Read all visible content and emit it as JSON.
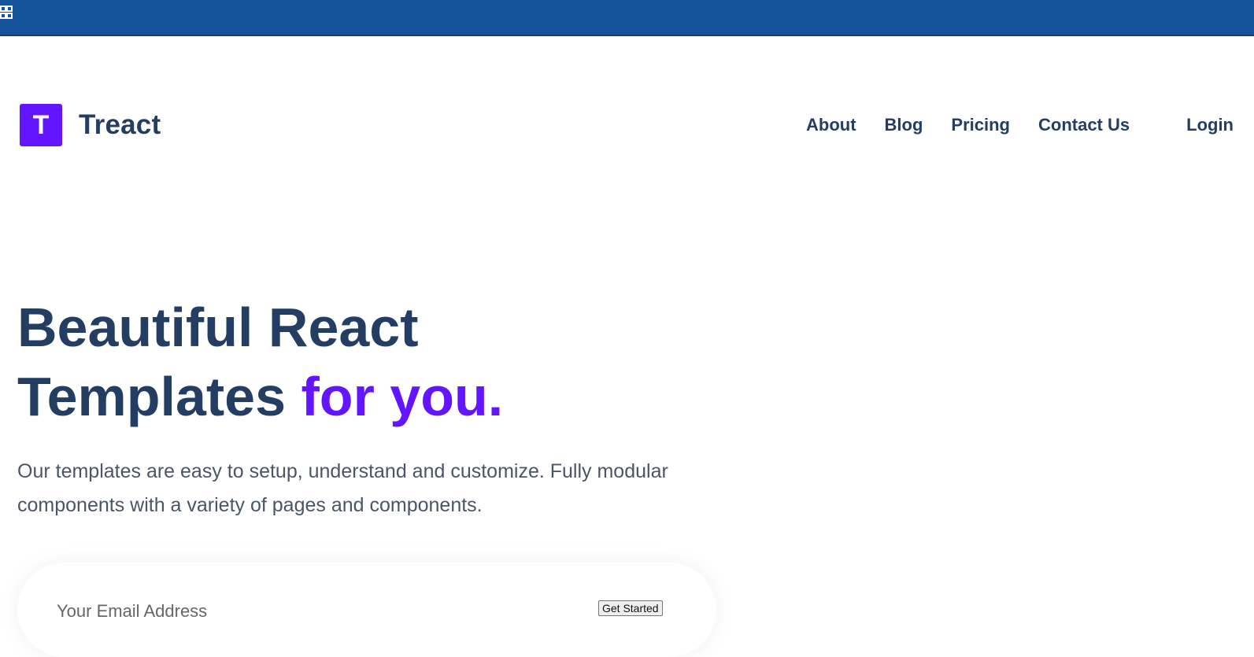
{
  "colors": {
    "topbar": "#15539a",
    "brand_accent": "#6415ff",
    "heading": "#243e63",
    "body_text": "#4a5568"
  },
  "topbar": {
    "icon": "grid-icon"
  },
  "brand": {
    "logo_letter": "T",
    "name": "Treact"
  },
  "nav": {
    "items": [
      "About",
      "Blog",
      "Pricing",
      "Contact Us"
    ],
    "login_label": "Login"
  },
  "hero": {
    "title_line1": "Beautiful React",
    "title_line2_plain": "Templates ",
    "title_line2_accent": "for you.",
    "description": "Our templates are easy to setup, understand and customize. Fully modular components with a variety of pages and components."
  },
  "signup": {
    "email_placeholder": "Your Email Address",
    "button_label": "Get Started"
  }
}
